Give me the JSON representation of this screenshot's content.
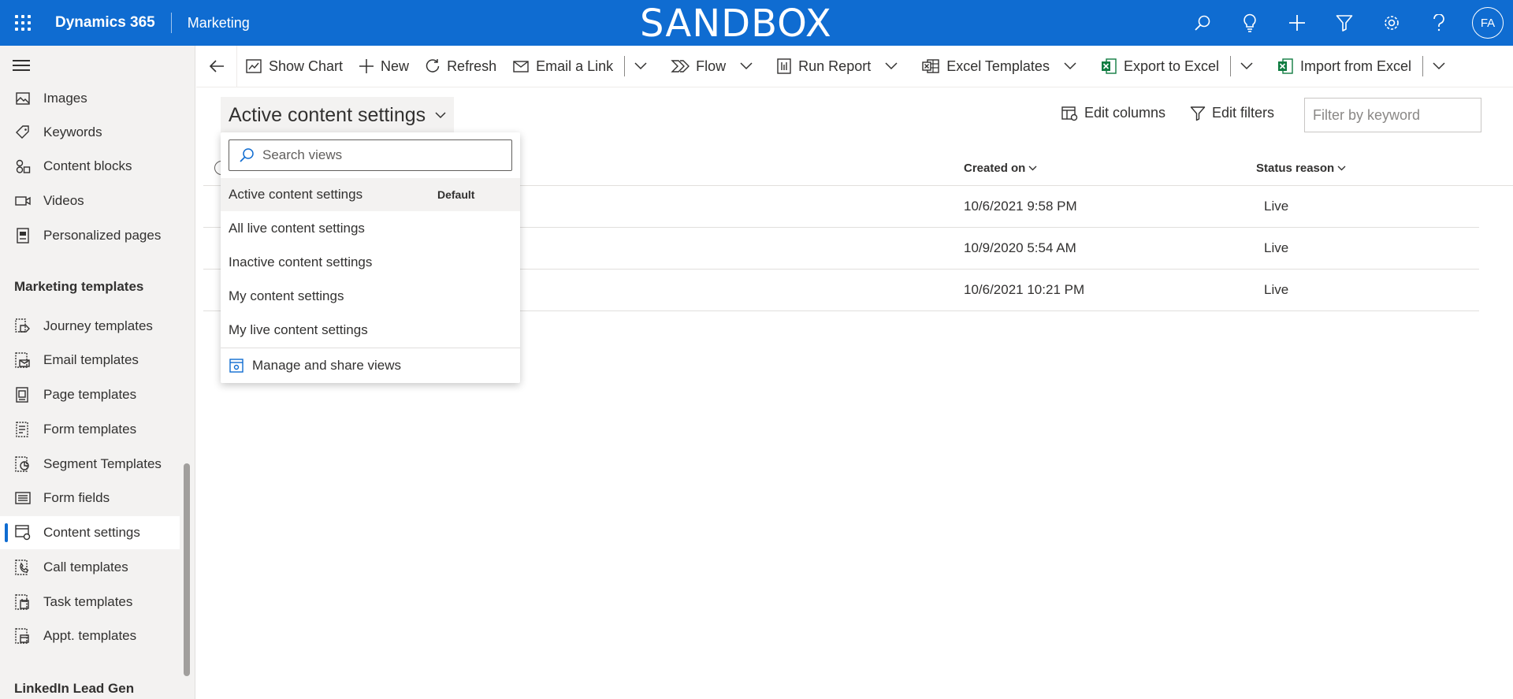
{
  "topbar": {
    "brand": "Dynamics 365",
    "app": "Marketing",
    "environment": "SANDBOX",
    "avatar_initials": "FA",
    "icons": [
      "search-icon",
      "lightbulb-icon",
      "plus-icon",
      "filter-icon",
      "gear-icon",
      "help-icon"
    ]
  },
  "sidebar": {
    "items": [
      {
        "label": "Images",
        "icon": "image-icon"
      },
      {
        "label": "Keywords",
        "icon": "tag-icon"
      },
      {
        "label": "Content blocks",
        "icon": "blocks-icon"
      },
      {
        "label": "Videos",
        "icon": "video-icon"
      },
      {
        "label": "Personalized pages",
        "icon": "page-icon"
      }
    ],
    "section_templates": "Marketing templates",
    "template_items": [
      {
        "label": "Journey templates",
        "icon": "journey-template-icon"
      },
      {
        "label": "Email templates",
        "icon": "email-template-icon"
      },
      {
        "label": "Page templates",
        "icon": "page-template-icon"
      },
      {
        "label": "Form templates",
        "icon": "form-template-icon"
      },
      {
        "label": "Segment Templates",
        "icon": "segment-template-icon"
      },
      {
        "label": "Form fields",
        "icon": "form-fields-icon"
      },
      {
        "label": "Content settings",
        "icon": "content-settings-icon",
        "selected": true
      },
      {
        "label": "Call templates",
        "icon": "call-template-icon"
      },
      {
        "label": "Task templates",
        "icon": "task-template-icon"
      },
      {
        "label": "Appt. templates",
        "icon": "appointment-template-icon"
      }
    ],
    "section_linkedin": "LinkedIn Lead Gen"
  },
  "commandbar": {
    "show_chart": "Show Chart",
    "new": "New",
    "refresh": "Refresh",
    "email_link": "Email a Link",
    "flow": "Flow",
    "run_report": "Run Report",
    "excel_templates": "Excel Templates",
    "export_excel": "Export to Excel",
    "import_excel": "Import from Excel"
  },
  "view": {
    "current": "Active content settings",
    "edit_columns": "Edit columns",
    "edit_filters": "Edit filters",
    "filter_placeholder": "Filter by keyword"
  },
  "grid": {
    "columns": {
      "created_on": "Created on",
      "status_reason": "Status reason"
    },
    "rows": [
      {
        "created_on": "10/6/2021 9:58 PM",
        "status": "Live"
      },
      {
        "created_on": "10/9/2020 5:54 AM",
        "status": "Live"
      },
      {
        "created_on": "10/6/2021 10:21 PM",
        "status": "Live"
      }
    ]
  },
  "view_dropdown": {
    "search_placeholder": "Search views",
    "default_badge": "Default",
    "views": [
      "Active content settings",
      "All live content settings",
      "Inactive content settings",
      "My content settings",
      "My live content settings"
    ],
    "manage": "Manage and share views"
  },
  "colors": {
    "topbar": "#0f6cd1",
    "accent": "#0f6cd1",
    "excel_green": "#107c41"
  }
}
